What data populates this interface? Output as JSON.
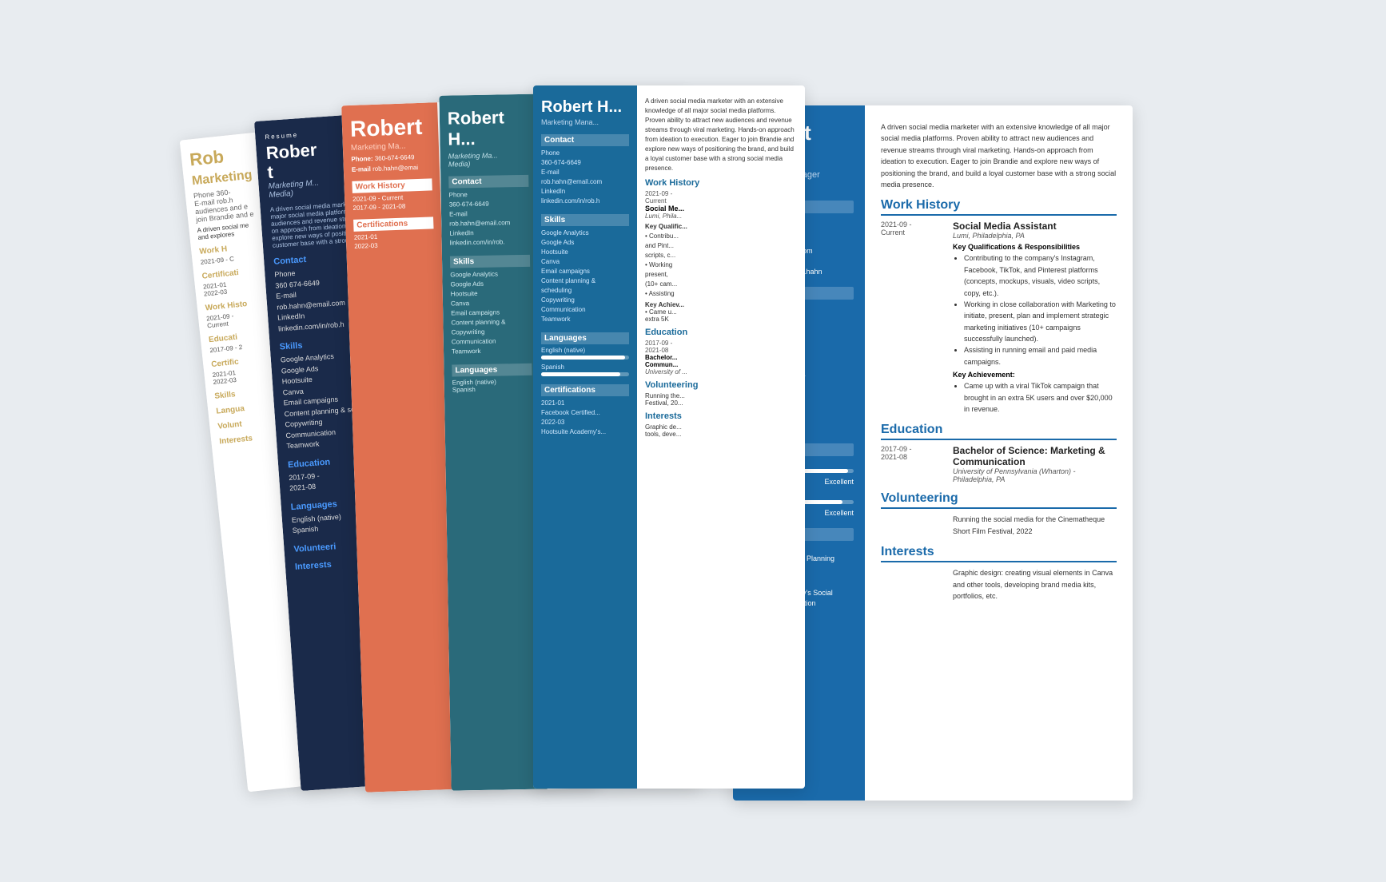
{
  "cards": {
    "person": {
      "first": "Robert",
      "last": "Hahn",
      "full": "Robert Hahn",
      "title": "Marketing Manager",
      "title_spec": "(Social Media)"
    },
    "contact": {
      "phone_label": "Phone",
      "phone": "360-674-6649",
      "email_label": "E-mail",
      "email": "rob.hahn@email.com",
      "linkedin_label": "Linkedin",
      "linkedin": "linkedin.com/in/rob.hahn"
    },
    "summary": "A driven social media marketer with an extensive knowledge of all major social media platforms. Proven ability to attract new audiences and revenue streams through viral marketing. Hands-on approach from ideation to execution. Eager to join Brandie and explore new ways of positioning the brand, and build a loyal customer base with a strong social media presence.",
    "work_history": {
      "label": "Work History",
      "job1": {
        "title": "Social Media Assistant",
        "company": "Lumi, Philadelphia, PA",
        "date": "2021-09 - Current",
        "kq_label": "Key Qualifications & Responsibilities",
        "bullets": [
          "Contributing to the company's Instagram, Facebook, TikTok, and Pinterest platforms (concepts, mockups, visuals, video scripts, copy, etc.).",
          "Working in close collaboration with Marketing to initiate, present, plan and implement strategic marketing initiatives (10+ campaigns successfully launched).",
          "Assisting in running email and paid media campaigns."
        ],
        "ka_label": "Key Achievement:",
        "achievement": "Came up with a viral TikTok campaign that brought in an extra 5K users and over $20,000 in revenue."
      }
    },
    "education": {
      "label": "Education",
      "entry": {
        "date": "2017-09 - 2021-08",
        "degree": "Bachelor of Science: Marketing & Communication",
        "school": "University of Pennsylvania (Wharton) - Philadelphia, PA"
      }
    },
    "skills": {
      "label": "Skills",
      "items": [
        "Google Analytics",
        "Google Ads",
        "Hootsuite",
        "Canva",
        "Email campaigns",
        "Content planning & scheduling",
        "Copywriting",
        "Communication",
        "Teamwork"
      ]
    },
    "languages": {
      "label": "Languages",
      "items": [
        {
          "name": "English (native)",
          "level": "Excellent",
          "pct": 95
        },
        {
          "name": "Spanish",
          "level": "Excellent",
          "pct": 90
        }
      ]
    },
    "certifications": {
      "label": "Certifications",
      "items": [
        {
          "date": "2021-01",
          "name": "Facebook Certified Planning Professional"
        },
        {
          "date": "2022-03",
          "name": "Hootsuite Academy's Social Marketing Certification"
        }
      ]
    },
    "volunteering": {
      "label": "Volunteering",
      "text": "Running the social media for the Cinematheque Short Film Festival, 2022"
    },
    "interests": {
      "label": "Interests",
      "text": "Graphic design: creating visual elements in Canva and other tools, developing brand media kits, portfolios, etc."
    }
  }
}
